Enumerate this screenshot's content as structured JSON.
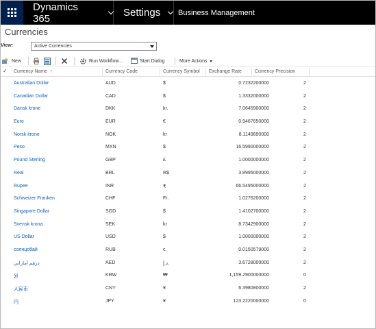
{
  "topbar": {
    "app_name": "Dynamics 365",
    "area": "Settings",
    "subarea": "Business Management"
  },
  "page": {
    "title": "Currencies",
    "view_label": "View:",
    "view_value": "Active Currencies"
  },
  "commands": {
    "new": "New",
    "run_workflow": "Run Workflow...",
    "start_dialog": "Start Dialog",
    "more_actions": "More Actions"
  },
  "columns": {
    "name": "Currency Name",
    "code": "Currency Code",
    "symbol": "Currency Symbol",
    "rate": "Exchange Rate",
    "precision": "Currency Precision"
  },
  "rows": [
    {
      "name": "Australian Dollar",
      "code": "AUD",
      "symbol": "$",
      "rate": "0.7232200000",
      "precision": "2"
    },
    {
      "name": "Canadian Dollar",
      "code": "CAD",
      "symbol": "$",
      "rate": "1.3332000000",
      "precision": "2"
    },
    {
      "name": "Dansk krone",
      "code": "DKK",
      "symbol": "kr.",
      "rate": "7.0645900000",
      "precision": "2"
    },
    {
      "name": "Euro",
      "code": "EUR",
      "symbol": "€",
      "rate": "0.9467650000",
      "precision": "2"
    },
    {
      "name": "Norsk krone",
      "code": "NOK",
      "symbol": "kr",
      "rate": "8.1149690000",
      "precision": "2"
    },
    {
      "name": "Peso",
      "code": "MXN",
      "symbol": "$",
      "rate": "16.5990000000",
      "precision": "2"
    },
    {
      "name": "Pound Sterling",
      "code": "GBP",
      "symbol": "£",
      "rate": "1.0000000000",
      "precision": "2"
    },
    {
      "name": "Real",
      "code": "BRL",
      "symbol": "R$",
      "rate": "3.8995000000",
      "precision": "2"
    },
    {
      "name": "Rupee",
      "code": "INR",
      "symbol": "₹",
      "rate": "66.5495000000",
      "precision": "2"
    },
    {
      "name": "Schweizer Franken",
      "code": "CHF",
      "symbol": "Fr.",
      "rate": "1.0276200000",
      "precision": "2"
    },
    {
      "name": "Singapore Dollar",
      "code": "SGD",
      "symbol": "$",
      "rate": "1.4102700000",
      "precision": "2"
    },
    {
      "name": "Svensk krona",
      "code": "SEK",
      "symbol": "kr",
      "rate": "8.7342900000",
      "precision": "2"
    },
    {
      "name": "US Dollar",
      "code": "USD",
      "symbol": "$",
      "rate": "1.0000000000",
      "precision": "2"
    },
    {
      "name": "солнцобай",
      "code": "RUB",
      "symbol": "с.",
      "rate": "0.0150579000",
      "precision": "2"
    },
    {
      "name": "درهم اماراتي",
      "code": "AED",
      "symbol": "د.إ.",
      "rate": "3.6728000000",
      "precision": "2"
    },
    {
      "name": "원",
      "code": "KRW",
      "symbol": "₩",
      "rate": "1,159.2900000000",
      "precision": "0"
    },
    {
      "name": "人民币",
      "code": "CNY",
      "symbol": "¥",
      "rate": "6.3980800000",
      "precision": "2"
    },
    {
      "name": "円",
      "code": "JPY",
      "symbol": "¥",
      "rate": "123.2220000000",
      "precision": "0"
    }
  ]
}
